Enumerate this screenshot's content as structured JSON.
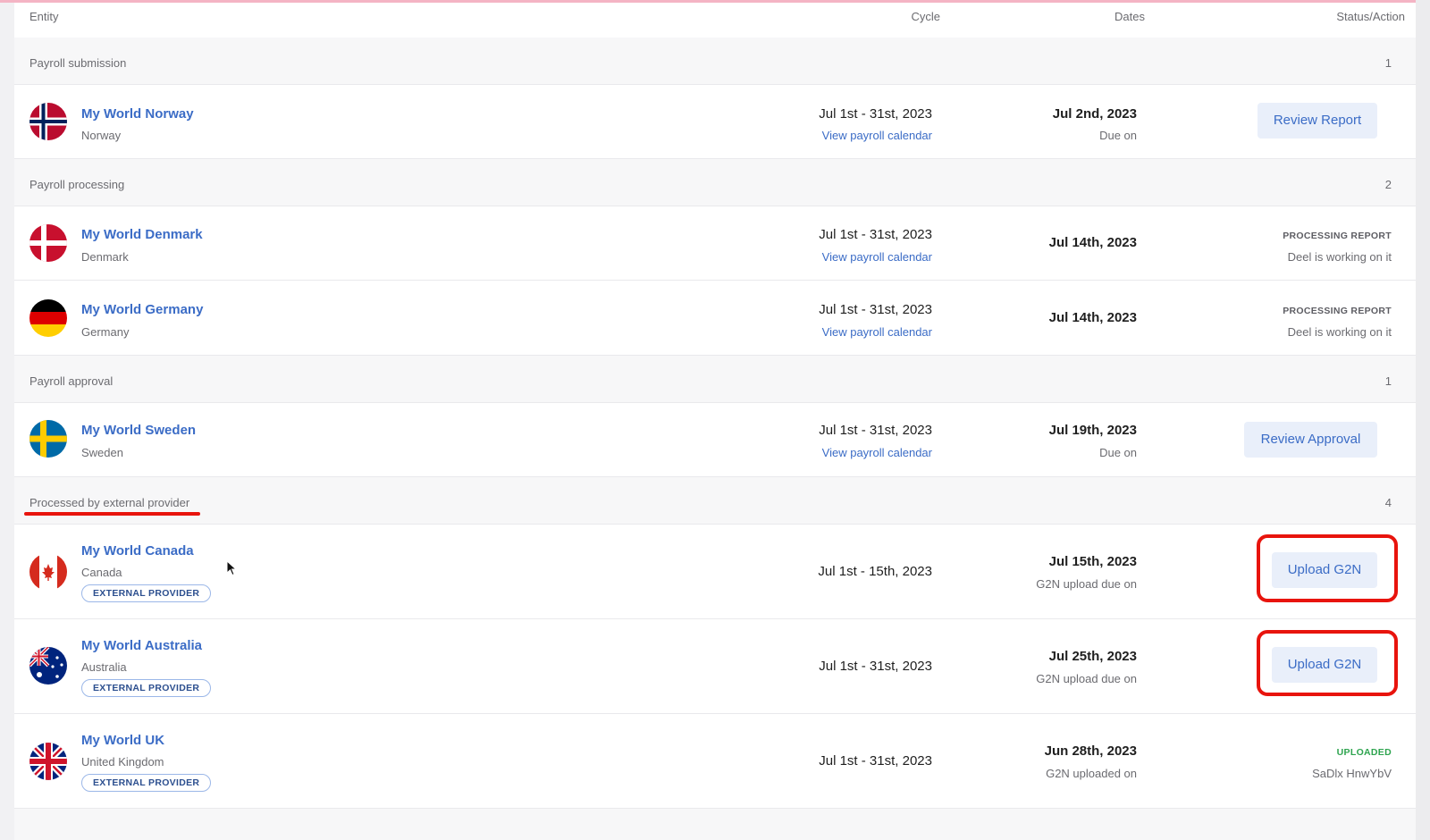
{
  "header": {
    "entity": "Entity",
    "cycle": "Cycle",
    "dates": "Dates",
    "status": "Status/Action"
  },
  "groups": [
    {
      "label": "Payroll submission",
      "count": "1"
    },
    {
      "label": "Payroll processing",
      "count": "2"
    },
    {
      "label": "Payroll approval",
      "count": "1"
    },
    {
      "label": "Processed by external provider",
      "count": "4"
    }
  ],
  "entities": [
    {
      "name": "My World Norway",
      "country": "Norway",
      "flag": "norway-flag-icon",
      "cycle": "Jul 1st - 31st, 2023",
      "calendar_link": "View payroll calendar",
      "date": "Jul 2nd, 2023",
      "date_sub": "Due on",
      "action": "Review Report"
    },
    {
      "name": "My World Denmark",
      "country": "Denmark",
      "flag": "denmark-flag-icon",
      "cycle": "Jul 1st - 31st, 2023",
      "calendar_link": "View payroll calendar",
      "date": "Jul 14th, 2023",
      "status": "PROCESSING REPORT",
      "status_sub": "Deel is working on it"
    },
    {
      "name": "My World Germany",
      "country": "Germany",
      "flag": "germany-flag-icon",
      "cycle": "Jul 1st - 31st, 2023",
      "calendar_link": "View payroll calendar",
      "date": "Jul 14th, 2023",
      "status": "PROCESSING REPORT",
      "status_sub": "Deel is working on it"
    },
    {
      "name": "My World Sweden",
      "country": "Sweden",
      "flag": "sweden-flag-icon",
      "cycle": "Jul 1st - 31st, 2023",
      "calendar_link": "View payroll calendar",
      "date": "Jul 19th, 2023",
      "date_sub": "Due on",
      "action": "Review Approval"
    },
    {
      "name": "My World Canada",
      "country": "Canada",
      "flag": "canada-flag-icon",
      "badge": "EXTERNAL PROVIDER",
      "cycle": "Jul 1st - 15th, 2023",
      "date": "Jul 15th, 2023",
      "date_sub": "G2N upload due on",
      "action": "Upload G2N"
    },
    {
      "name": "My World Australia",
      "country": "Australia",
      "flag": "australia-flag-icon",
      "badge": "EXTERNAL PROVIDER",
      "cycle": "Jul 1st - 31st, 2023",
      "date": "Jul 25th, 2023",
      "date_sub": "G2N upload due on",
      "action": "Upload G2N"
    },
    {
      "name": "My World UK",
      "country": "United Kingdom",
      "flag": "uk-flag-icon",
      "badge": "EXTERNAL PROVIDER",
      "cycle": "Jul 1st - 31st, 2023",
      "date": "Jun 28th, 2023",
      "date_sub": "G2N uploaded on",
      "status": "UPLOADED",
      "status_sub": "SaDlx HnwYbV"
    }
  ],
  "colors": {
    "link": "#3b6cc6",
    "button_bg": "#e9effa",
    "highlight": "#e8140d",
    "uploaded": "#2ea44f"
  }
}
